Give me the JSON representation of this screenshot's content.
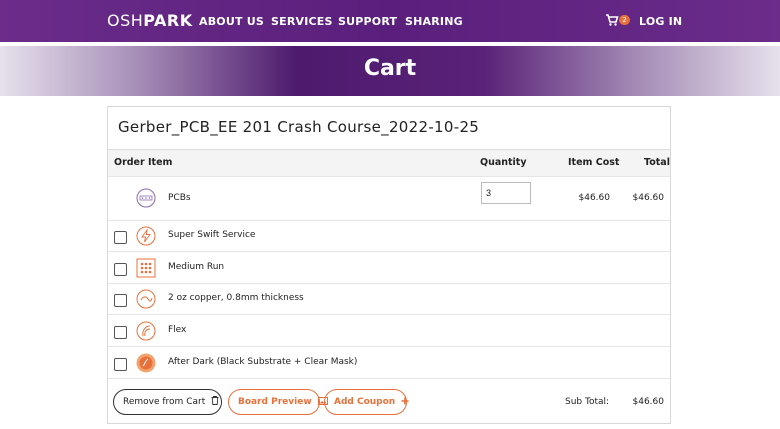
{
  "nav": {
    "logo_light": "OSH",
    "logo_bold": "PARK",
    "links": [
      "ABOUT US",
      "SERVICES",
      "SUPPORT",
      "SHARING"
    ],
    "cart_count": "2",
    "login": "LOG IN"
  },
  "banner": {
    "title": "Cart"
  },
  "cart": {
    "title": "Gerber_PCB_EE 201 Crash Course_2022-10-25",
    "headers": {
      "item": "Order Item",
      "quantity": "Quantity",
      "cost": "Item Cost",
      "total": "Total"
    },
    "pcb": {
      "label": "PCBs",
      "quantity": "3",
      "cost": "$46.60",
      "total": "$46.60"
    },
    "options": [
      {
        "label": "Super Swift Service",
        "icon": "lightning-icon",
        "checked": false
      },
      {
        "label": "Medium Run",
        "icon": "grid-icon",
        "checked": false
      },
      {
        "label": "2 oz copper, 0.8mm thickness",
        "icon": "copper-icon",
        "checked": false
      },
      {
        "label": "Flex",
        "icon": "flex-icon",
        "checked": false
      },
      {
        "label": "After Dark (Black Substrate + Clear Mask)",
        "icon": "after-dark-icon",
        "checked": false
      }
    ],
    "buttons": {
      "remove": "Remove from Cart",
      "preview": "Board Preview",
      "coupon": "Add Coupon"
    },
    "subtotal_label": "Sub Total:",
    "subtotal": "$46.60"
  },
  "colors": {
    "nav_purple": "#5a1f7c",
    "accent_orange": "#e8703a",
    "pcb_icon": "#8a6bb0"
  }
}
